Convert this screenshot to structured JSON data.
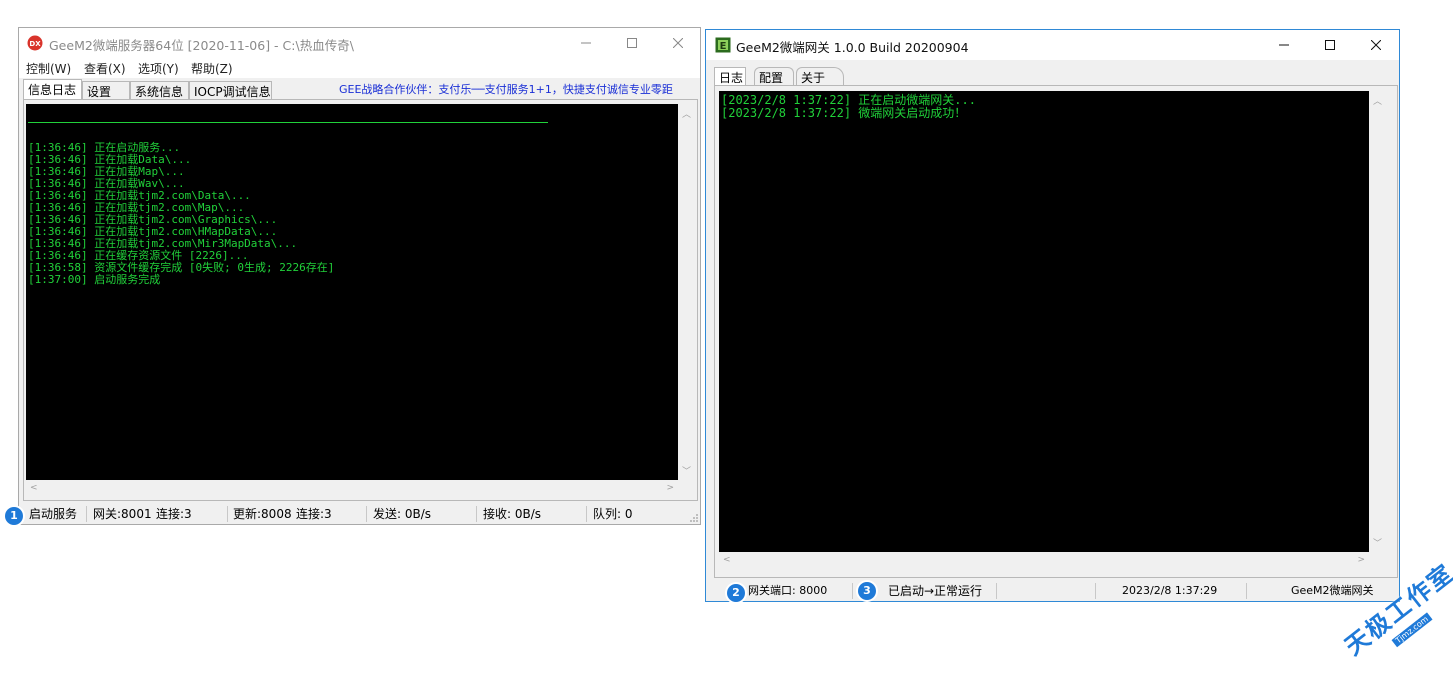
{
  "left_window": {
    "title": "GeeM2微端服务器64位 [2020-11-06] - C:\\热血传奇\\",
    "menu": [
      "控制(W)",
      "查看(X)",
      "选项(Y)",
      "帮助(Z)"
    ],
    "tabs": [
      "信息日志",
      "设置",
      "系统信息",
      "IOCP调试信息"
    ],
    "marquee": "GEE战略合作伙伴：支付乐──支付服务1+1，快捷支付诚信专业零距",
    "log_lines": [
      "[1:36:46] 正在启动服务...",
      "[1:36:46] 正在加载Data\\...",
      "[1:36:46] 正在加载Map\\...",
      "[1:36:46] 正在加载Wav\\...",
      "[1:36:46] 正在加载tjm2.com\\Data\\...",
      "[1:36:46] 正在加载tjm2.com\\Map\\...",
      "[1:36:46] 正在加载tjm2.com\\Graphics\\...",
      "[1:36:46] 正在加载tjm2.com\\HMapData\\...",
      "[1:36:46] 正在加载tjm2.com\\Mir3MapData\\...",
      "[1:36:46] 正在缓存资源文件 [2226]...",
      "[1:36:58] 资源文件缓存完成 [0失败; 0生成; 2226存在]",
      "[1:37:00] 启动服务完成"
    ],
    "status": {
      "badge": "1",
      "service": "启动服务",
      "gateway": "网关:8001",
      "gateway_conn": "连接:3",
      "update": "更新:8008",
      "update_conn": "连接:3",
      "send": "发送: 0B/s",
      "recv": "接收: 0B/s",
      "queue": "队列: 0"
    }
  },
  "right_window": {
    "title": "GeeM2微端网关 1.0.0 Build 20200904",
    "tabs": [
      "日志",
      "配置",
      "关于"
    ],
    "log_lines": [
      "[2023/2/8 1:37:22] 正在启动微端网关...",
      "[2023/2/8 1:37:22] 微端网关启动成功！"
    ],
    "status": {
      "badge2": "2",
      "port": "网关端口: 8000",
      "badge3": "3",
      "state": "已启动→正常运行",
      "datetime": "2023/2/8 1:37:29",
      "name": "GeeM2微端网关"
    }
  },
  "watermark": {
    "text": "天极工作室",
    "sub": "Tjmz.com"
  },
  "colors": {
    "console_text": "#21d13a",
    "console_bg": "#000000",
    "badge": "#1f7ad8",
    "marquee": "#1a2fd6"
  }
}
